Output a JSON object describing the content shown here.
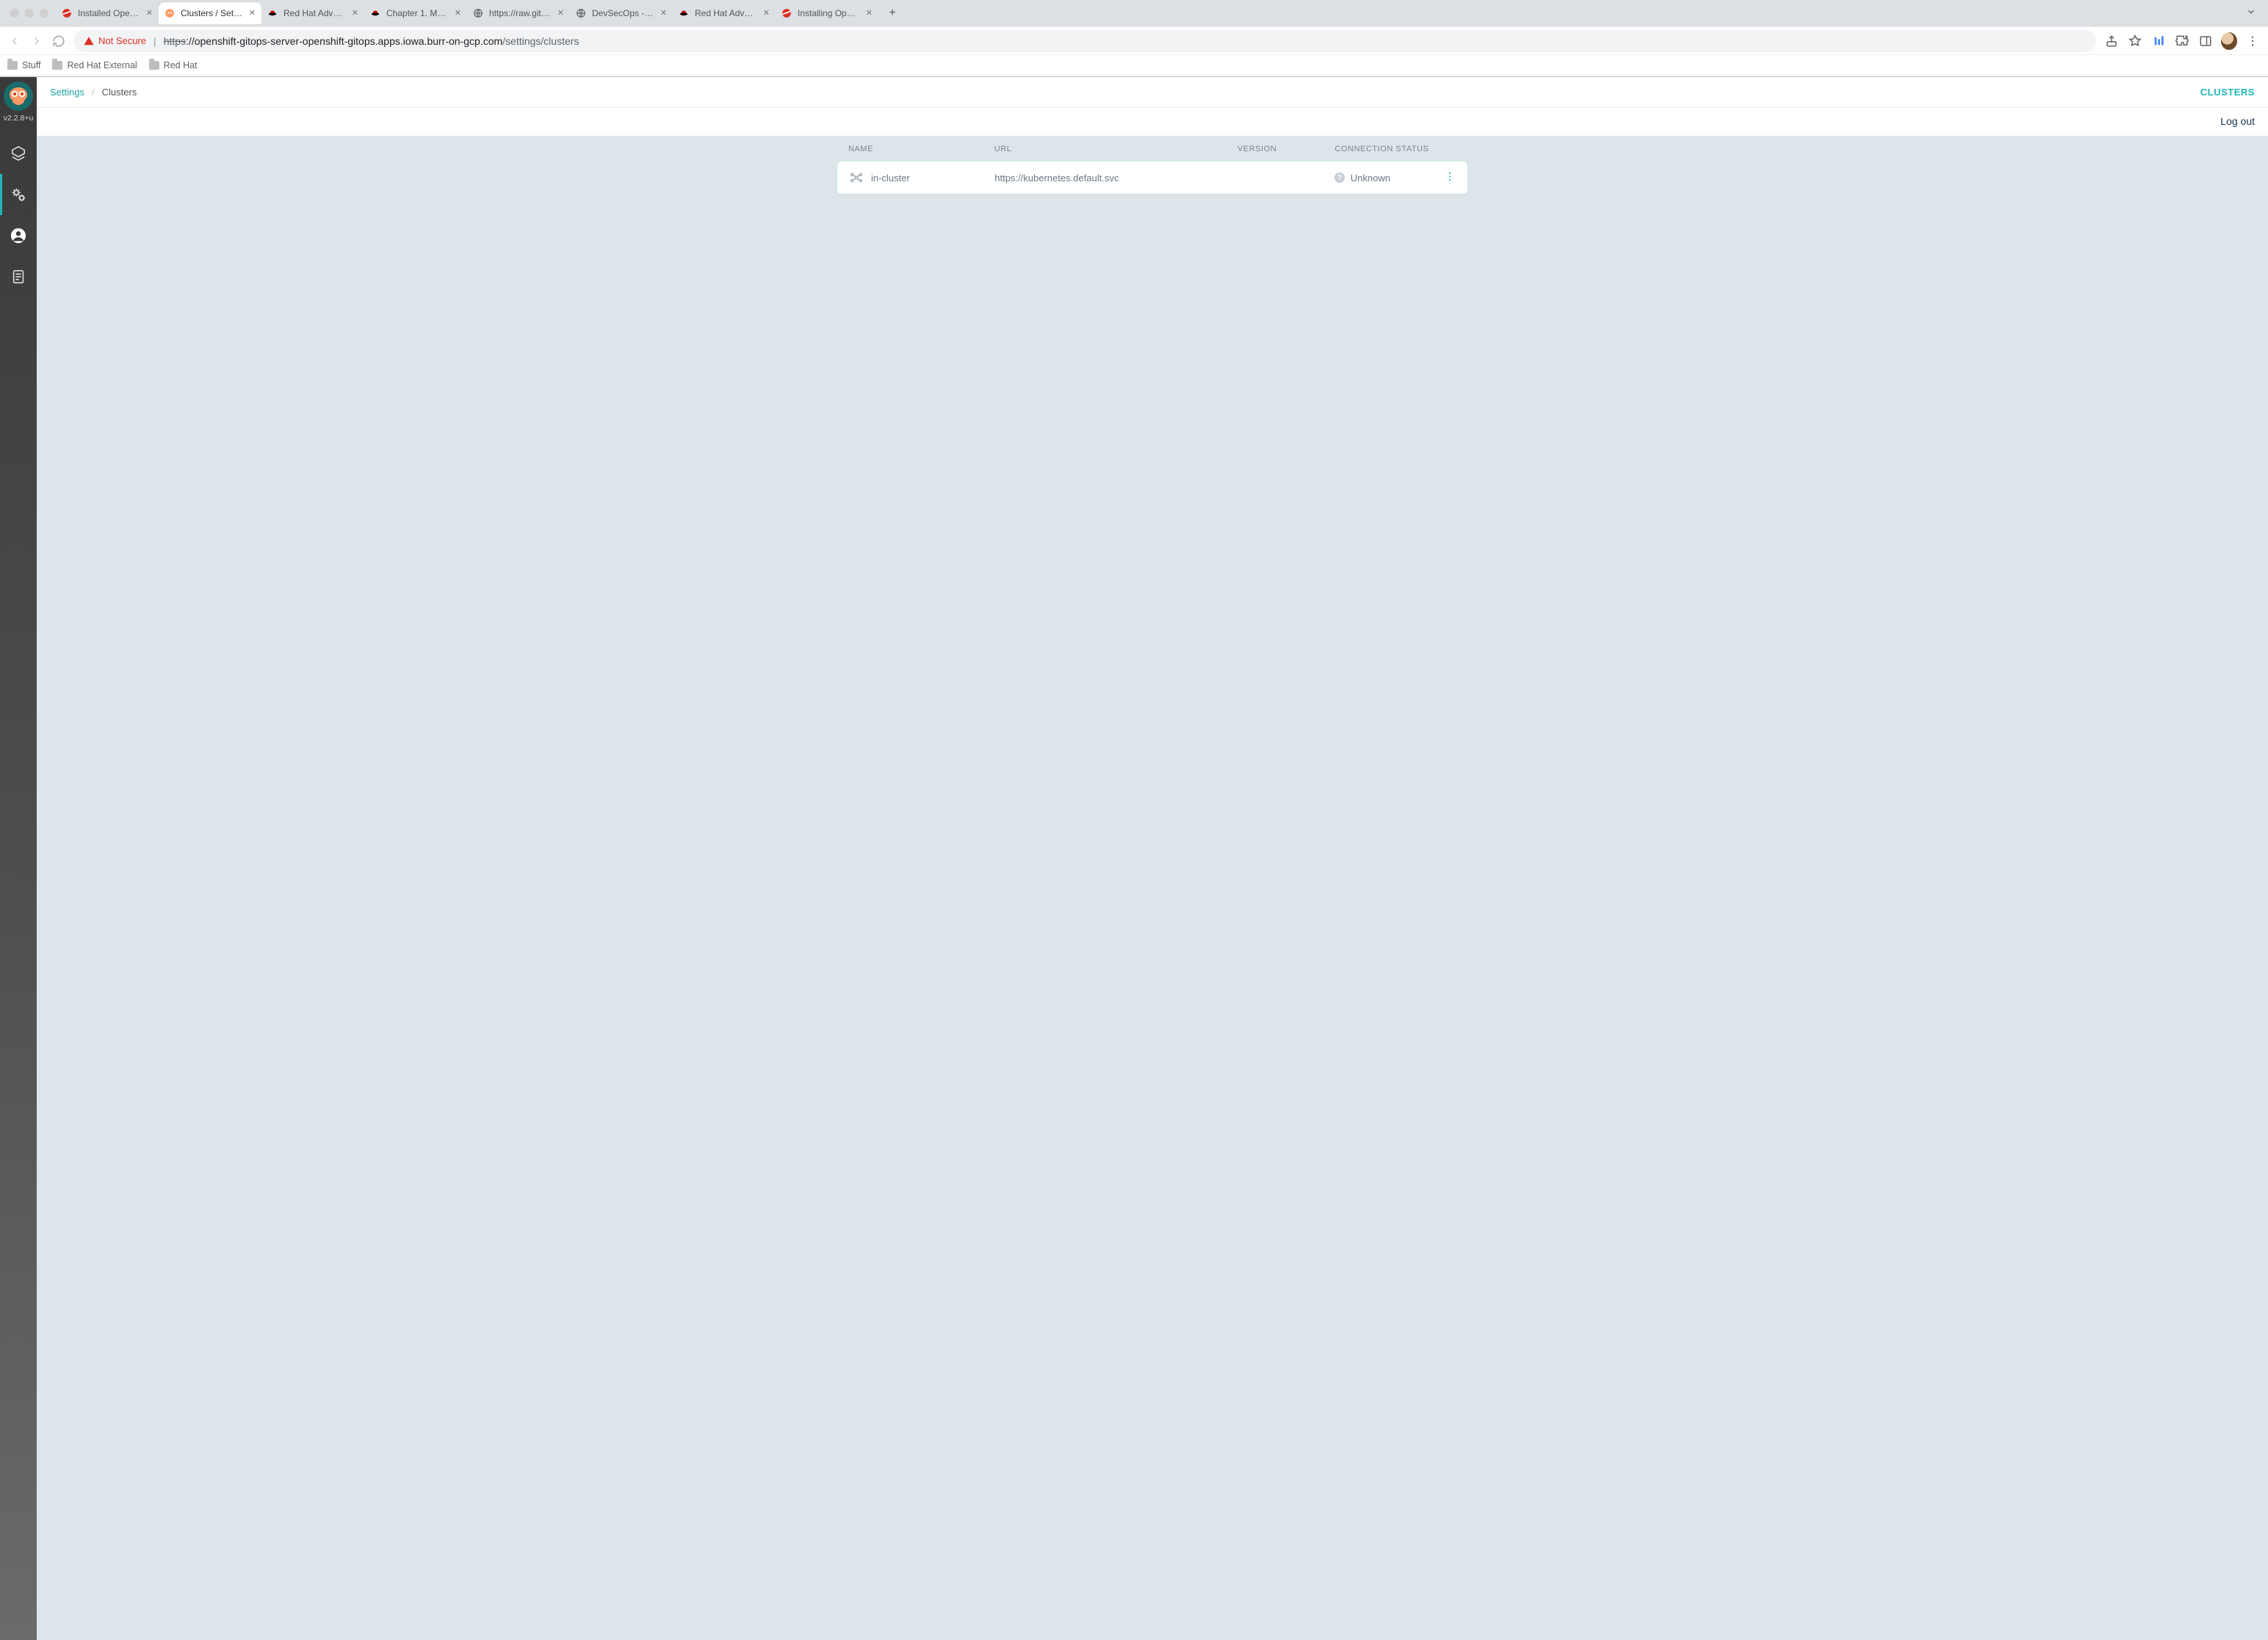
{
  "chrome": {
    "tabs": [
      {
        "title": "Installed Operators",
        "fav": "openshift"
      },
      {
        "title": "Clusters / Settings",
        "fav": "argo",
        "active": true
      },
      {
        "title": "Red Hat Advanced",
        "fav": "redhat"
      },
      {
        "title": "Chapter 1. Manag",
        "fav": "redhat"
      },
      {
        "title": "https://raw.github",
        "fav": "globe"
      },
      {
        "title": "DevSecOps - Dev",
        "fav": "globe"
      },
      {
        "title": "Red Hat Advanced",
        "fav": "redhat"
      },
      {
        "title": "Installing OpenSh",
        "fav": "openshift"
      }
    ],
    "security_label": "Not Secure",
    "url_protocol": "https",
    "url_host": "://openshift-gitops-server-openshift-gitops.apps.iowa.burr-on-gcp.com",
    "url_path": "/settings/clusters",
    "bookmarks": [
      "Stuff",
      "Red Hat External",
      "Red Hat"
    ]
  },
  "sidebar": {
    "version": "v2.2.8+u"
  },
  "page": {
    "breadcrumb_root": "Settings",
    "breadcrumb_current": "Clusters",
    "title_right": "CLUSTERS",
    "logout": "Log out",
    "columns": {
      "name": "NAME",
      "url": "URL",
      "version": "VERSION",
      "conn": "CONNECTION STATUS"
    },
    "rows": [
      {
        "name": "in-cluster",
        "url": "https://kubernetes.default.svc",
        "version": "",
        "conn": "Unknown"
      }
    ]
  }
}
